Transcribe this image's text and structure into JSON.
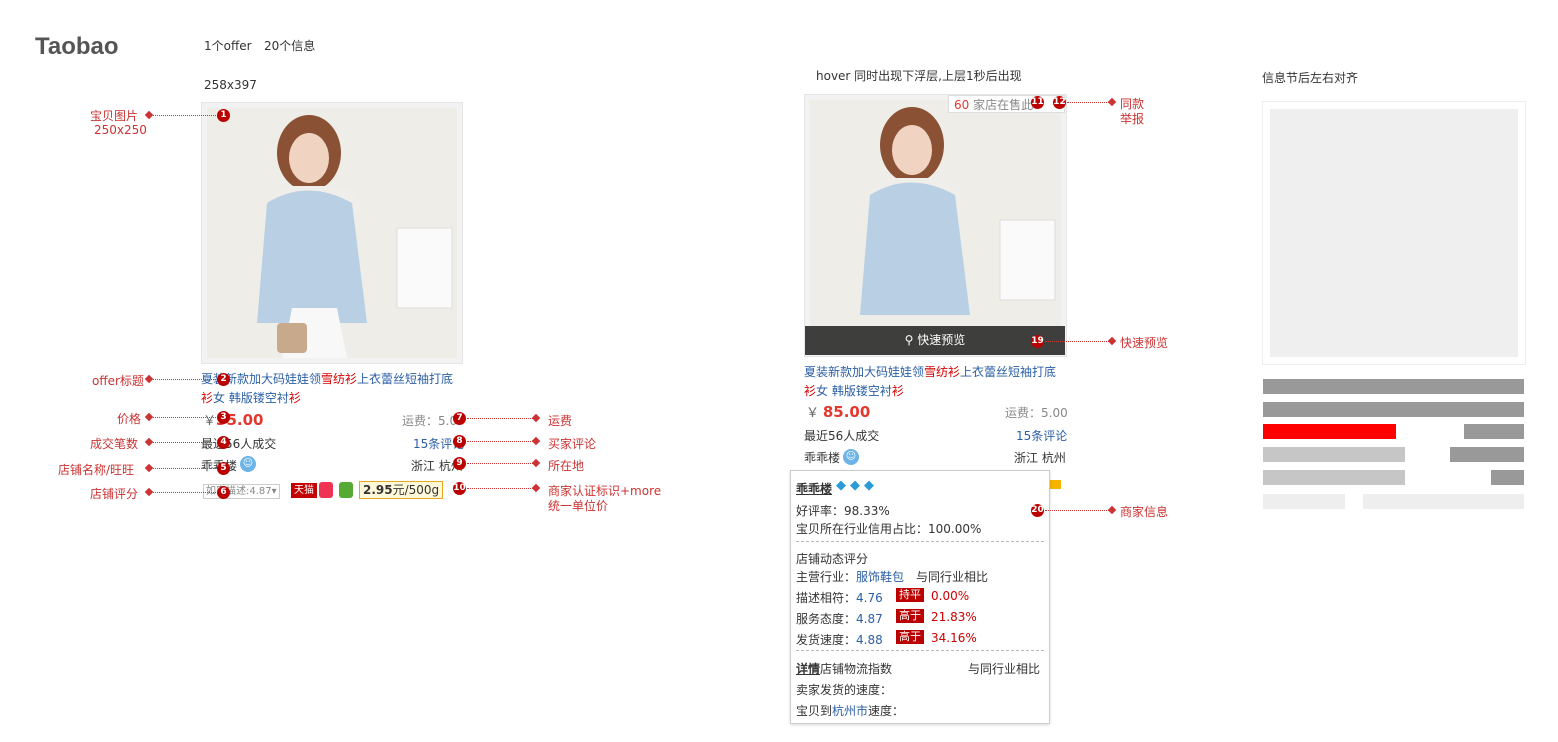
{
  "header": {
    "logo": "Taobao",
    "offer_count": "1个offer",
    "info_count": "20个信息",
    "size_label": "258x397"
  },
  "annotations": {
    "left": [
      {
        "label": "宝贝图片",
        "sub": "250x250"
      },
      {
        "label": "offer标题"
      },
      {
        "label": "价格"
      },
      {
        "label": "成交笔数"
      },
      {
        "label": "店铺名称/旺旺"
      },
      {
        "label": "店铺评分"
      }
    ],
    "right": [
      {
        "label": "运费"
      },
      {
        "label": "买家评论"
      },
      {
        "label": "所在地"
      },
      {
        "label": "商家认证标识+more",
        "sub": "统一单位价"
      }
    ],
    "hover": [
      {
        "label": "同款",
        "sub": "举报"
      },
      {
        "label": "快速预览"
      },
      {
        "label": "商家信息"
      }
    ],
    "numbers": [
      "1",
      "2",
      "3",
      "4",
      "5",
      "6",
      "7",
      "8",
      "9",
      "10",
      "11",
      "12",
      "19",
      "20"
    ]
  },
  "card": {
    "title_part1": "夏装新款加大码娃娃领",
    "title_red1": "雪纺衫",
    "title_part2": "上衣蕾丝短袖打底",
    "title_red2": "衫",
    "title_part3": "女 韩版镂空衬",
    "title_red3": "衫",
    "price_symbol": "￥",
    "price": "85.00",
    "freight": "运费：5.00",
    "sales": "最近56人成交",
    "reviews": "15条评论",
    "shop": "乖乖楼",
    "location": "浙江 杭州",
    "score_label": "如实描述:4.87",
    "tmall_badge": "天猫",
    "unit_price": "2.95",
    "unit_suffix": "元/500g"
  },
  "card_short": {
    "price": "35.00",
    "freight": "运费：5.0",
    "sales": "最近56人成交",
    "reviews": "15条评论",
    "location": "浙江 杭州"
  },
  "hover_card": {
    "caption": "hover 同时出现下浮层,上层1秒后出现",
    "same_shops_count": "60",
    "same_shops_text": "家店在售此",
    "quick_preview": "快速预览"
  },
  "popup": {
    "shop_name": "乖乖楼",
    "good_rate": "好评率：98.33%",
    "industry_credit": "宝贝所在行业信用占比：100.00%",
    "dsr_title": "店铺动态评分",
    "main_industry_label": "主营行业：",
    "main_industry_value": "服饰鞋包",
    "compare_label": "与同行业相比",
    "rows": [
      {
        "label": "描述相符：",
        "score": "4.76",
        "badge": "持平",
        "pct": "0.00%"
      },
      {
        "label": "服务态度：",
        "score": "4.87",
        "badge": "高于",
        "pct": "21.83%"
      },
      {
        "label": "发货速度：",
        "score": "4.88",
        "badge": "高于",
        "pct": "34.16%"
      }
    ],
    "logistics_link": "详情",
    "logistics_title": "店铺物流指数",
    "logistics_compare": "与同行业相比",
    "seller_speed": "卖家发货的速度：",
    "arrive_prefix": "宝贝到",
    "arrive_city": "杭州市",
    "arrive_suffix": "速度："
  },
  "right_panel": {
    "caption": "信息节后左右对齐"
  },
  "colors": {
    "accent_red": "#e4382f",
    "link_blue": "#2b5fa5",
    "annotation_red": "#cc3333",
    "skeleton_red": "#ff0000"
  }
}
